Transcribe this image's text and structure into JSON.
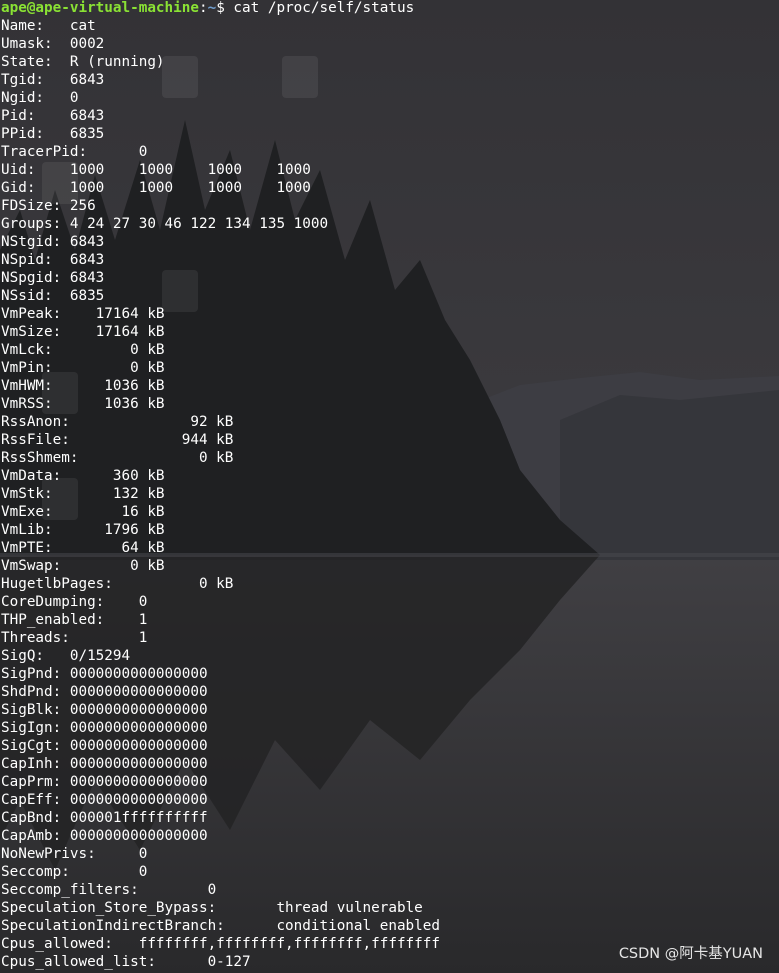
{
  "prompt": {
    "user_host": "ape@ape-virtual-machine",
    "separator": ":",
    "path": "~",
    "symbol": "$ ",
    "command": "cat /proc/self/status"
  },
  "lines": [
    "Name:\tcat",
    "Umask:\t0002",
    "State:\tR (running)",
    "Tgid:\t6843",
    "Ngid:\t0",
    "Pid:\t6843",
    "PPid:\t6835",
    "TracerPid:\t0",
    "Uid:\t1000\t1000\t1000\t1000",
    "Gid:\t1000\t1000\t1000\t1000",
    "FDSize:\t256",
    "Groups:\t4 24 27 30 46 122 134 135 1000",
    "NStgid:\t6843",
    "NSpid:\t6843",
    "NSpgid:\t6843",
    "NSsid:\t6835",
    "VmPeak:\t   17164 kB",
    "VmSize:\t   17164 kB",
    "VmLck:\t       0 kB",
    "VmPin:\t       0 kB",
    "VmHWM:\t    1036 kB",
    "VmRSS:\t    1036 kB",
    "RssAnon:\t      92 kB",
    "RssFile:\t     944 kB",
    "RssShmem:\t       0 kB",
    "VmData:\t     360 kB",
    "VmStk:\t     132 kB",
    "VmExe:\t      16 kB",
    "VmLib:\t    1796 kB",
    "VmPTE:\t      64 kB",
    "VmSwap:\t       0 kB",
    "HugetlbPages:\t       0 kB",
    "CoreDumping:\t0",
    "THP_enabled:\t1",
    "Threads:\t1",
    "SigQ:\t0/15294",
    "SigPnd:\t0000000000000000",
    "ShdPnd:\t0000000000000000",
    "SigBlk:\t0000000000000000",
    "SigIgn:\t0000000000000000",
    "SigCgt:\t0000000000000000",
    "CapInh:\t0000000000000000",
    "CapPrm:\t0000000000000000",
    "CapEff:\t0000000000000000",
    "CapBnd:\t000001ffffffffff",
    "CapAmb:\t0000000000000000",
    "NoNewPrivs:\t0",
    "Seccomp:\t0",
    "Seccomp_filters:\t0",
    "Speculation_Store_Bypass:\tthread vulnerable",
    "SpeculationIndirectBranch:\tconditional enabled",
    "Cpus_allowed:\tffffffff,ffffffff,ffffffff,ffffffff",
    "Cpus_allowed_list:\t0-127"
  ],
  "watermark": "CSDN @阿卡基YUAN",
  "colors": {
    "prompt_user": "#8ae234",
    "prompt_path": "#729fcf",
    "text": "#ffffff",
    "background": "#2e2d31"
  }
}
